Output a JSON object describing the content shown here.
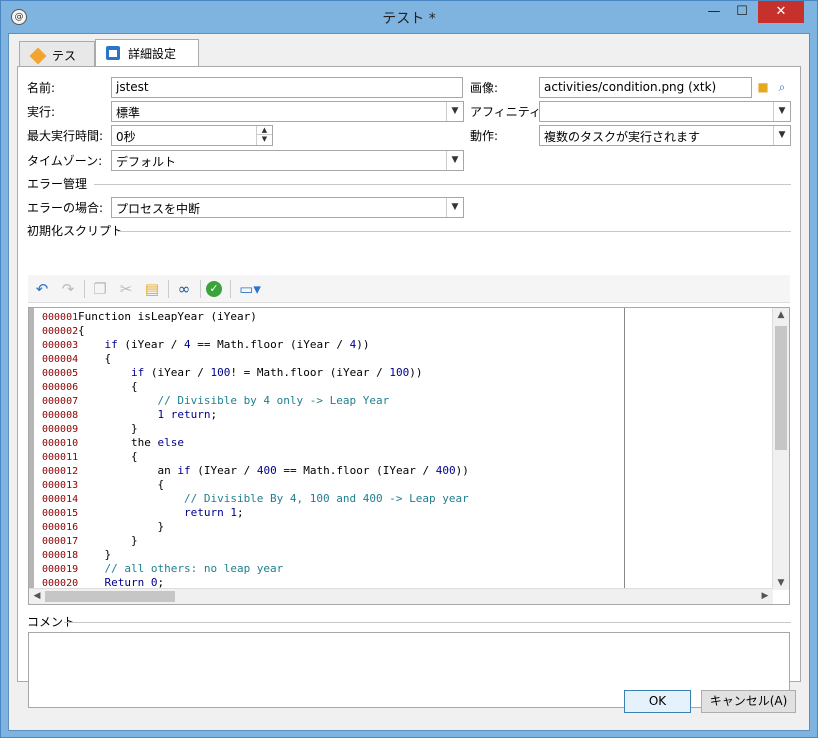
{
  "window": {
    "title": "テスト *",
    "app_icon": "@",
    "minimize": "—",
    "maximize": "☐",
    "close": "✕"
  },
  "tabs": [
    {
      "label": "テスト",
      "icon": "diamond-icon"
    },
    {
      "label": "詳細設定",
      "icon": "clipboard-icon",
      "active": true
    }
  ],
  "form": {
    "name_label": "名前:",
    "name_value": "jstest",
    "exec_label": "実行:",
    "exec_value": "標準",
    "maxtime_label": "最大実行時間:",
    "maxtime_value": "0秒",
    "timezone_label": "タイムゾーン:",
    "timezone_value": "デフォルト",
    "image_label": "画像:",
    "image_value": "activities/condition.png (xtk)",
    "affinity_label": "アフィニティー:",
    "affinity_value": "",
    "action_label": "動作:",
    "action_value": "複数のタスクが実行されます"
  },
  "error_section": {
    "title": "エラー管理",
    "on_error_label": "エラーの場合:",
    "on_error_value": "プロセスを中断"
  },
  "script_section": {
    "title": "初期化スクリプト",
    "toolbar": [
      "undo-icon",
      "redo-icon",
      "copy-icon",
      "cut-icon",
      "paste-icon",
      "find-icon",
      "check-icon",
      "insert-icon"
    ]
  },
  "code_lines": [
    {
      "n": "000001",
      "t": "Function isLeapYear (iYear)"
    },
    {
      "n": "000002",
      "t": "{"
    },
    {
      "n": "000003",
      "t": "    if (iYear / 4 == Math.floor (iYear / 4))"
    },
    {
      "n": "000004",
      "t": "    {"
    },
    {
      "n": "000005",
      "t": "        if (iYear / 100! = Math.floor (iYear / 100))"
    },
    {
      "n": "000006",
      "t": "        {"
    },
    {
      "n": "000007",
      "t": "            // Divisible by 4 only -> Leap Year"
    },
    {
      "n": "000008",
      "t": "            1 return;"
    },
    {
      "n": "000009",
      "t": "        }"
    },
    {
      "n": "000010",
      "t": "        the else"
    },
    {
      "n": "000011",
      "t": "        {"
    },
    {
      "n": "000012",
      "t": "            an if (IYear / 400 == Math.floor (IYear / 400))"
    },
    {
      "n": "000013",
      "t": "            {"
    },
    {
      "n": "000014",
      "t": "                // Divisible By 4, 100 and 400 -> Leap year"
    },
    {
      "n": "000015",
      "t": "                return 1;"
    },
    {
      "n": "000016",
      "t": "            }"
    },
    {
      "n": "000017",
      "t": "        }"
    },
    {
      "n": "000018",
      "t": "    }"
    },
    {
      "n": "000019",
      "t": "    // all others: no leap year"
    },
    {
      "n": "000020",
      "t": "    Return 0;"
    }
  ],
  "comment_section": {
    "title": "コメント",
    "value": ""
  },
  "buttons": {
    "ok": "OK",
    "cancel": "キャンセル(A)"
  },
  "colors": {
    "title_bar": "#7fb3e0",
    "close_button": "#c7312b",
    "line_number": "#8b0000",
    "keyword": "#00008b",
    "comment": "#1f7f8f"
  }
}
